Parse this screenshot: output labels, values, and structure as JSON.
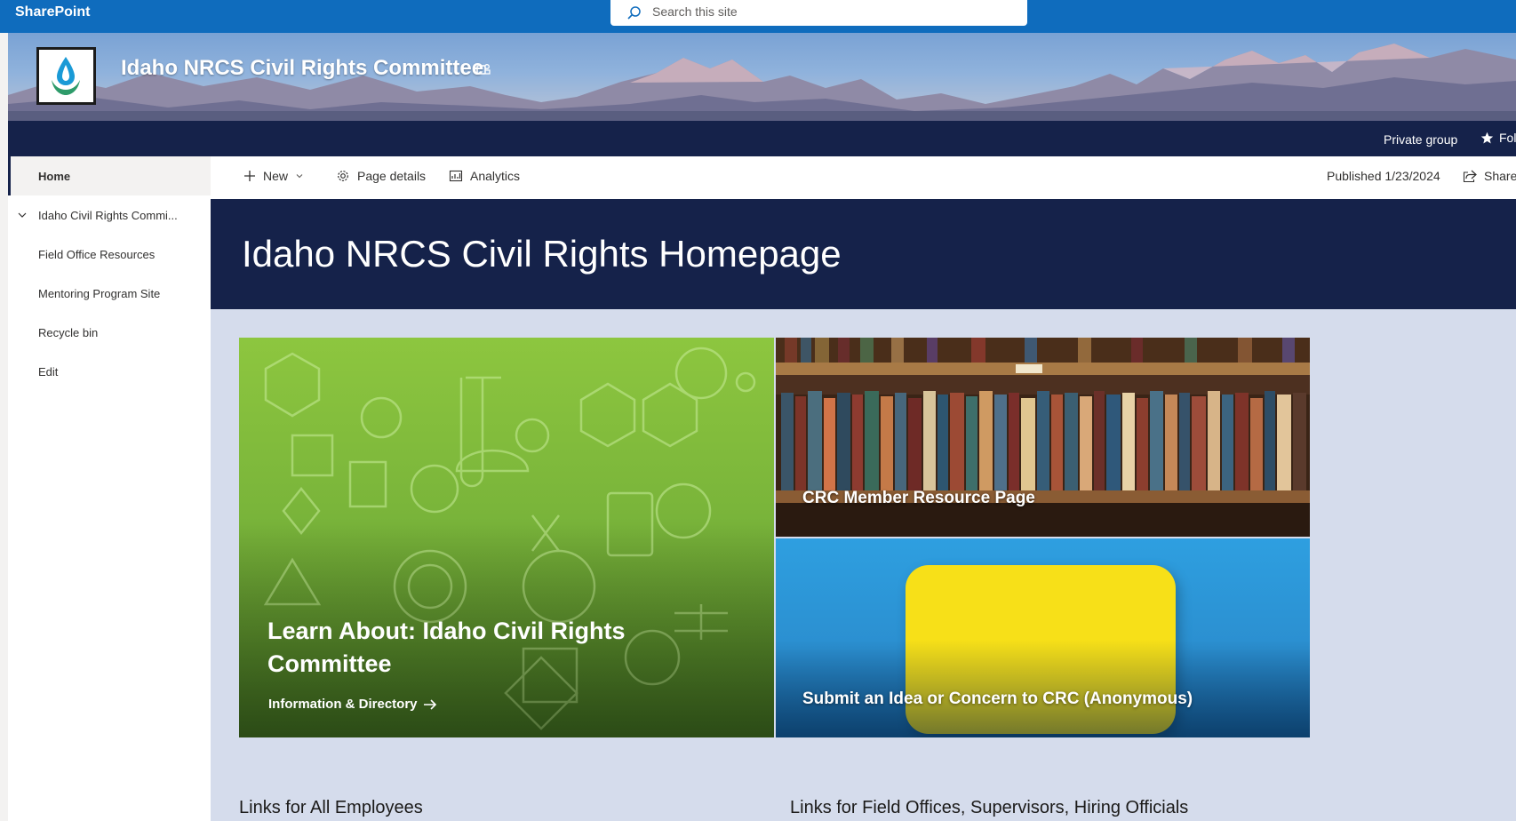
{
  "suite": {
    "brand": "SharePoint",
    "search_placeholder": "Search this site"
  },
  "site": {
    "title": "Idaho NRCS Civil Rights Committee",
    "privacy": "Private group",
    "follow_label": "Follo"
  },
  "nav": {
    "items": [
      {
        "label": "Home",
        "active": true
      },
      {
        "label": "Idaho Civil Rights Commi...",
        "expandable": true
      },
      {
        "label": "Field Office Resources"
      },
      {
        "label": "Mentoring Program Site"
      },
      {
        "label": "Recycle bin"
      },
      {
        "label": "Edit"
      }
    ]
  },
  "commandbar": {
    "new_label": "New",
    "page_details_label": "Page details",
    "analytics_label": "Analytics",
    "published": "Published 1/23/2024",
    "share_label": "Share"
  },
  "page": {
    "title": "Idaho NRCS Civil Rights Homepage"
  },
  "hero": {
    "main_title": "Learn About: Idaho Civil Rights Committee",
    "main_link": "Information & Directory",
    "tile2_title": "CRC Member Resource Page",
    "tile3_title": "Submit an Idea or Concern to CRC (Anonymous)"
  },
  "sections": {
    "left_heading": "Links for All Employees",
    "right_heading": "Links for Field Offices, Supervisors, Hiring Officials"
  },
  "colors": {
    "suite_bar": "#0f6cbd",
    "navy": "#15224a",
    "page_bg": "#d5dcec",
    "hero_green": "#8dc63f",
    "bubble_yellow": "#f7e018"
  },
  "icons": [
    "search-icon",
    "teams-icon",
    "star-icon",
    "add-icon",
    "chevron-down-icon",
    "gear-icon",
    "analytics-icon",
    "share-icon",
    "arrow-right-icon",
    "water-drop-logo"
  ]
}
